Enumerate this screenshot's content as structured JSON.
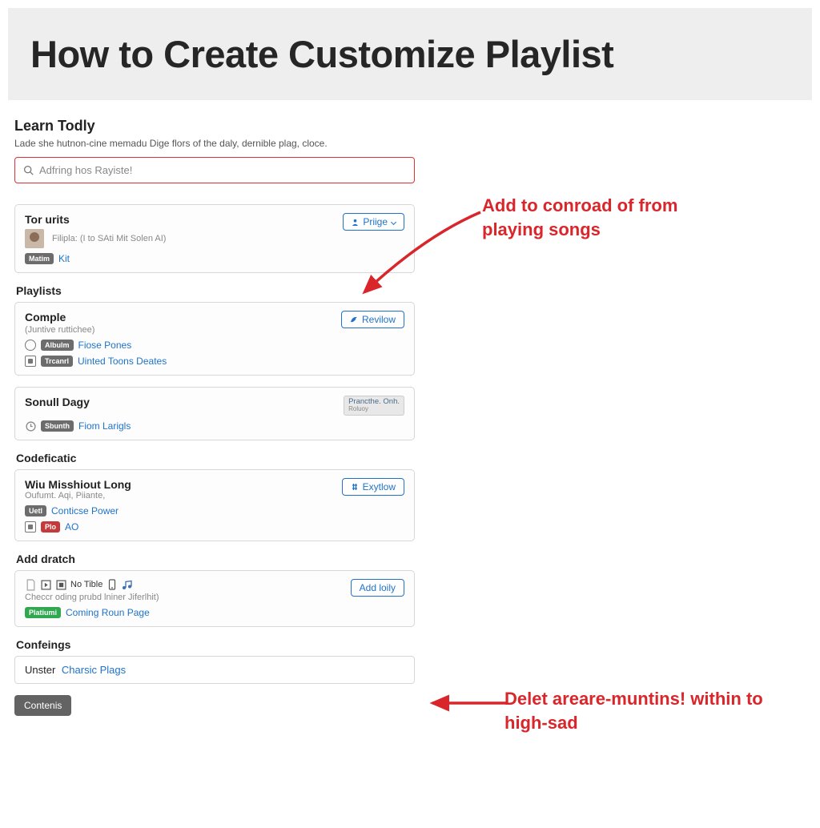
{
  "banner": {
    "title": "How to Create Customize Playlist"
  },
  "learn": {
    "title": "Learn Todly",
    "desc": "Lade she hutnon-cine memadu Dige flors of the daly, dernible plag, cloce."
  },
  "search": {
    "placeholder": "Adfring hos Rayiste!"
  },
  "card1": {
    "title": "Tor urits",
    "meta": "Filipla: (I to SAti Mit Solen AI)",
    "badge": "Matim",
    "link": "Kit",
    "btn": "Priige"
  },
  "playlists_label": "Playlists",
  "card2": {
    "title": "Comple",
    "sub": "(Juntive ruttichee)",
    "btn": "Revilow",
    "r1_badge": "Albulm",
    "r1_link": "Fiose Pones",
    "r2_badge": "Trcanrl",
    "r2_link": "Uinted Toons Deates"
  },
  "card3": {
    "title": "Sonull Dagy",
    "btn1": "Prancthe. Onh.",
    "btn1_sub": "Roluoy",
    "badge": "Sbunth",
    "link": "Fiom Larigls"
  },
  "codef_label": "Codeficatic",
  "card4": {
    "title": "Wiu Misshiout Long",
    "sub": "Oufumt. Aqi, Piiante,",
    "btn": "Exytlow",
    "r1_badge": "Uetl",
    "r1_link": "Conticse Power",
    "r2_badge": "Plo",
    "r2_text": "AO"
  },
  "addd_label": "Add dratch",
  "card5": {
    "notitle": "No Tible",
    "sub": "Checcr oding prubd lniner Jiferlhit)",
    "btn": "Add loily",
    "badge": "Platiumi",
    "link": "Coming Roun Page"
  },
  "confe_label": "Confeings",
  "card6": {
    "text": "Unster",
    "link": "Charsic Plags"
  },
  "footer_btn": "Contenis",
  "annot1": "Add to conroad of from playing songs",
  "annot2": "Delet areare-muntins! within to high-sad"
}
